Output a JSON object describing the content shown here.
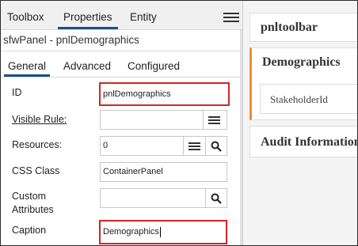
{
  "top_tabs": {
    "toolbox": "Toolbox",
    "properties": "Properties",
    "entity": "Entity"
  },
  "panel_title": "sfwPanel - pnlDemographics",
  "sub_tabs": {
    "general": "General",
    "advanced": "Advanced",
    "configured": "Configured"
  },
  "fields": {
    "id": {
      "label": "ID",
      "value": "pnlDemographics"
    },
    "visible_rule": {
      "label": "Visible Rule:",
      "value": ""
    },
    "resources": {
      "label": "Resources:",
      "value": "0"
    },
    "css_class": {
      "label": "CSS Class",
      "value": "ContainerPanel"
    },
    "custom_attributes": {
      "label_line1": "Custom",
      "label_line2": "Attributes",
      "value": ""
    },
    "caption": {
      "label": "Caption",
      "value": "Demographics"
    }
  },
  "right": {
    "toolbar_title": "pnltoolbar",
    "demographics_title": "Demographics",
    "stakeholder_col": "StakeholderId",
    "audit_title": "Audit Information"
  },
  "colors": {
    "highlight": "#d32424",
    "tab_underline": "#1a4f8a",
    "card_accent": "#e8912d"
  },
  "icons": [
    "hamburger-menu-icon",
    "menu-icon",
    "search-icon"
  ]
}
